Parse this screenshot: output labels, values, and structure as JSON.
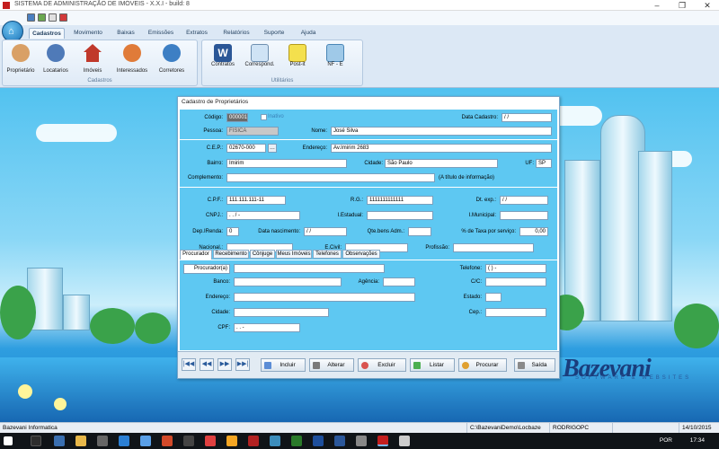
{
  "window": {
    "title": "SISTEMA DE ADMINISTRAÇÃO DE IMÓVEIS - X.X.I - build: 8"
  },
  "ribbon": {
    "tabs": [
      "Cadastros",
      "Movimento",
      "Baixas",
      "Emissões",
      "Extratos",
      "Relatórios",
      "Suporte",
      "Ajuda"
    ],
    "groups": [
      {
        "label": "Cadastros",
        "buttons": [
          "Proprietário",
          "Locatarios",
          "Imóveis",
          "Interessados",
          "Corretores"
        ]
      },
      {
        "label": "Utilitários",
        "buttons": [
          "Contratos",
          "Correspond.",
          "Post-it",
          "NF - E"
        ]
      }
    ]
  },
  "form": {
    "title": "Cadastro de Proprietários",
    "codigo_label": "Código:",
    "codigo_value": "000001",
    "inativo_label": "Inativo",
    "data_cadastro_label": "Data Cadastro:",
    "data_cadastro_value": "/ /",
    "pessoa_label": "Pessoa:",
    "pessoa_value": "FISICA",
    "nome_label": "Nome:",
    "nome_value": "José Silva",
    "cep_label": "C.E.P.:",
    "cep_value": "02670-000",
    "endereco_label": "Endereço:",
    "endereco_value": "Av.Imirim 2683",
    "bairro_label": "Bairro:",
    "bairro_value": "Imirim",
    "cidade_label": "Cidade:",
    "cidade_value": "São Paulo",
    "uf_label": "UF:",
    "uf_value": "SP",
    "complemento_label": "Complemento:",
    "complemento_hint": "(A título de informação)",
    "cpf_label": "C.P.F.:",
    "cpf_value": "111.111.111-11",
    "rg_label": "R.G.:",
    "rg_value": "1111111111111",
    "dtexp_label": "Dt. exp.:",
    "dtexp_value": "/ /",
    "cnpj_label": "CNPJ.:",
    "cnpj_value": ". . / -",
    "iestadual_label": "I.Estadual:",
    "imunicipal_label": "I.Municipal:",
    "depirenda_label": "Dep.IRenda:",
    "depirenda_value": "0",
    "datanasc_label": "Data nascimento:",
    "datanasc_value": "/ /",
    "qtebens_label": "Qte.bens Adm.:",
    "taxa_label": "% de Taxa por serviço:",
    "taxa_value": "0,00",
    "nacional_label": "Nacional.:",
    "ecivil_label": "E.Civil:",
    "profissao_label": "Profissão:"
  },
  "subtabs": [
    "Procurador",
    "Recebimento",
    "Cônjuge",
    "Meus Imóveis",
    "Telefones",
    "Observações"
  ],
  "procurador": {
    "procurador_label": "Procurador(a)",
    "telefone_label": "Telefone:",
    "telefone_value": "( ) -",
    "banco_label": "Banco:",
    "agencia_label": "Agência:",
    "cc_label": "C/C:",
    "endereco_label": "Endereço:",
    "estado_label": "Estado:",
    "cidade_label": "Cidade:",
    "cep_label": "Cep.:",
    "cpf_label": "CPF:",
    "cpf_value": ". . -"
  },
  "toolbar": {
    "nav": [
      "|◀◀",
      "◀◀",
      "▶▶",
      "▶▶|"
    ],
    "buttons": [
      "Incluir",
      "Alterar",
      "Excluir",
      "Listar",
      "Procurar",
      "Saída"
    ]
  },
  "logo": {
    "text": "Bazevani",
    "tagline": "SOFTWARE & WEBSITES"
  },
  "status": {
    "company": "Bazevani Informatica",
    "path": "C:\\BazevaniDemo\\Locbaze",
    "computer": "RODRIGOPC",
    "date": "14/10/2015"
  },
  "taskbar": {
    "lang": "POR",
    "time": "17:34"
  }
}
